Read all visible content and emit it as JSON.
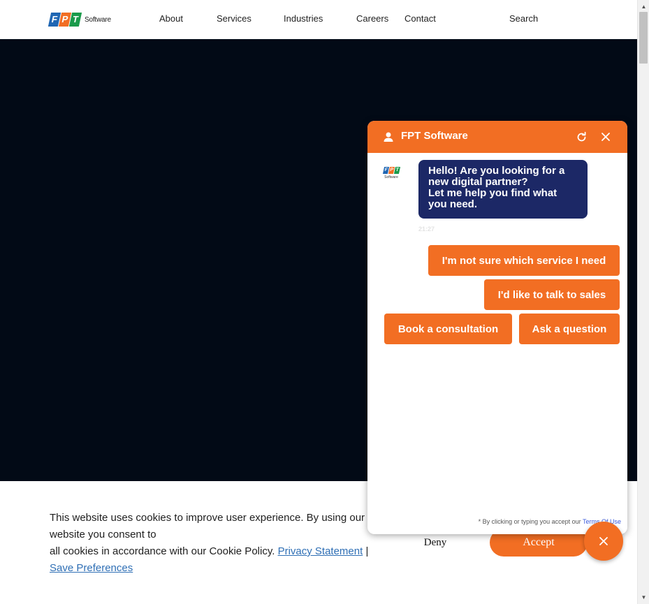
{
  "brand": {
    "logo_letters": [
      "F",
      "P",
      "T"
    ],
    "logo_colors": [
      "#1f66b3",
      "#f26e23",
      "#1a9b4b"
    ],
    "logo_word": "Software"
  },
  "nav": {
    "items": [
      "About",
      "Services",
      "Industries",
      "Careers",
      "Contact"
    ],
    "search_label": "Search"
  },
  "cookie": {
    "text_line1": "This website uses cookies to improve user experience. By using our website you consent to",
    "text_line2": "all cookies in accordance with our Cookie Policy.",
    "privacy_link": "Privacy Statement",
    "separator": "|",
    "preferences_link": "Save Preferences",
    "deny_label": "Deny",
    "accept_label": "Accept"
  },
  "chat": {
    "title": "FPT Software",
    "avatar_word": "Software",
    "bot_message": "Hello! Are you looking for a new digital partner? Let me help you find what you need.",
    "bot_message_line1": "Hello! Are you looking for a",
    "bot_message_line2": "new digital partner?",
    "bot_message_line3": "Let me help you find what",
    "bot_message_line4": "you need.",
    "timestamp": "21:27",
    "quick_replies": [
      "I'm not sure which service I need",
      "I'd like to talk to sales",
      "Book a consultation",
      "Ask a question"
    ],
    "footer_text": "* By clicking or typing you accept our",
    "terms_link": "Terms Of Use"
  },
  "colors": {
    "accent": "#f26e23",
    "hero_bg": "#020a16",
    "bot_bubble": "#1c2866"
  },
  "icons": {
    "chat_user": "user-icon",
    "chat_refresh": "refresh-icon",
    "chat_close": "close-icon",
    "fab": "close-icon"
  }
}
